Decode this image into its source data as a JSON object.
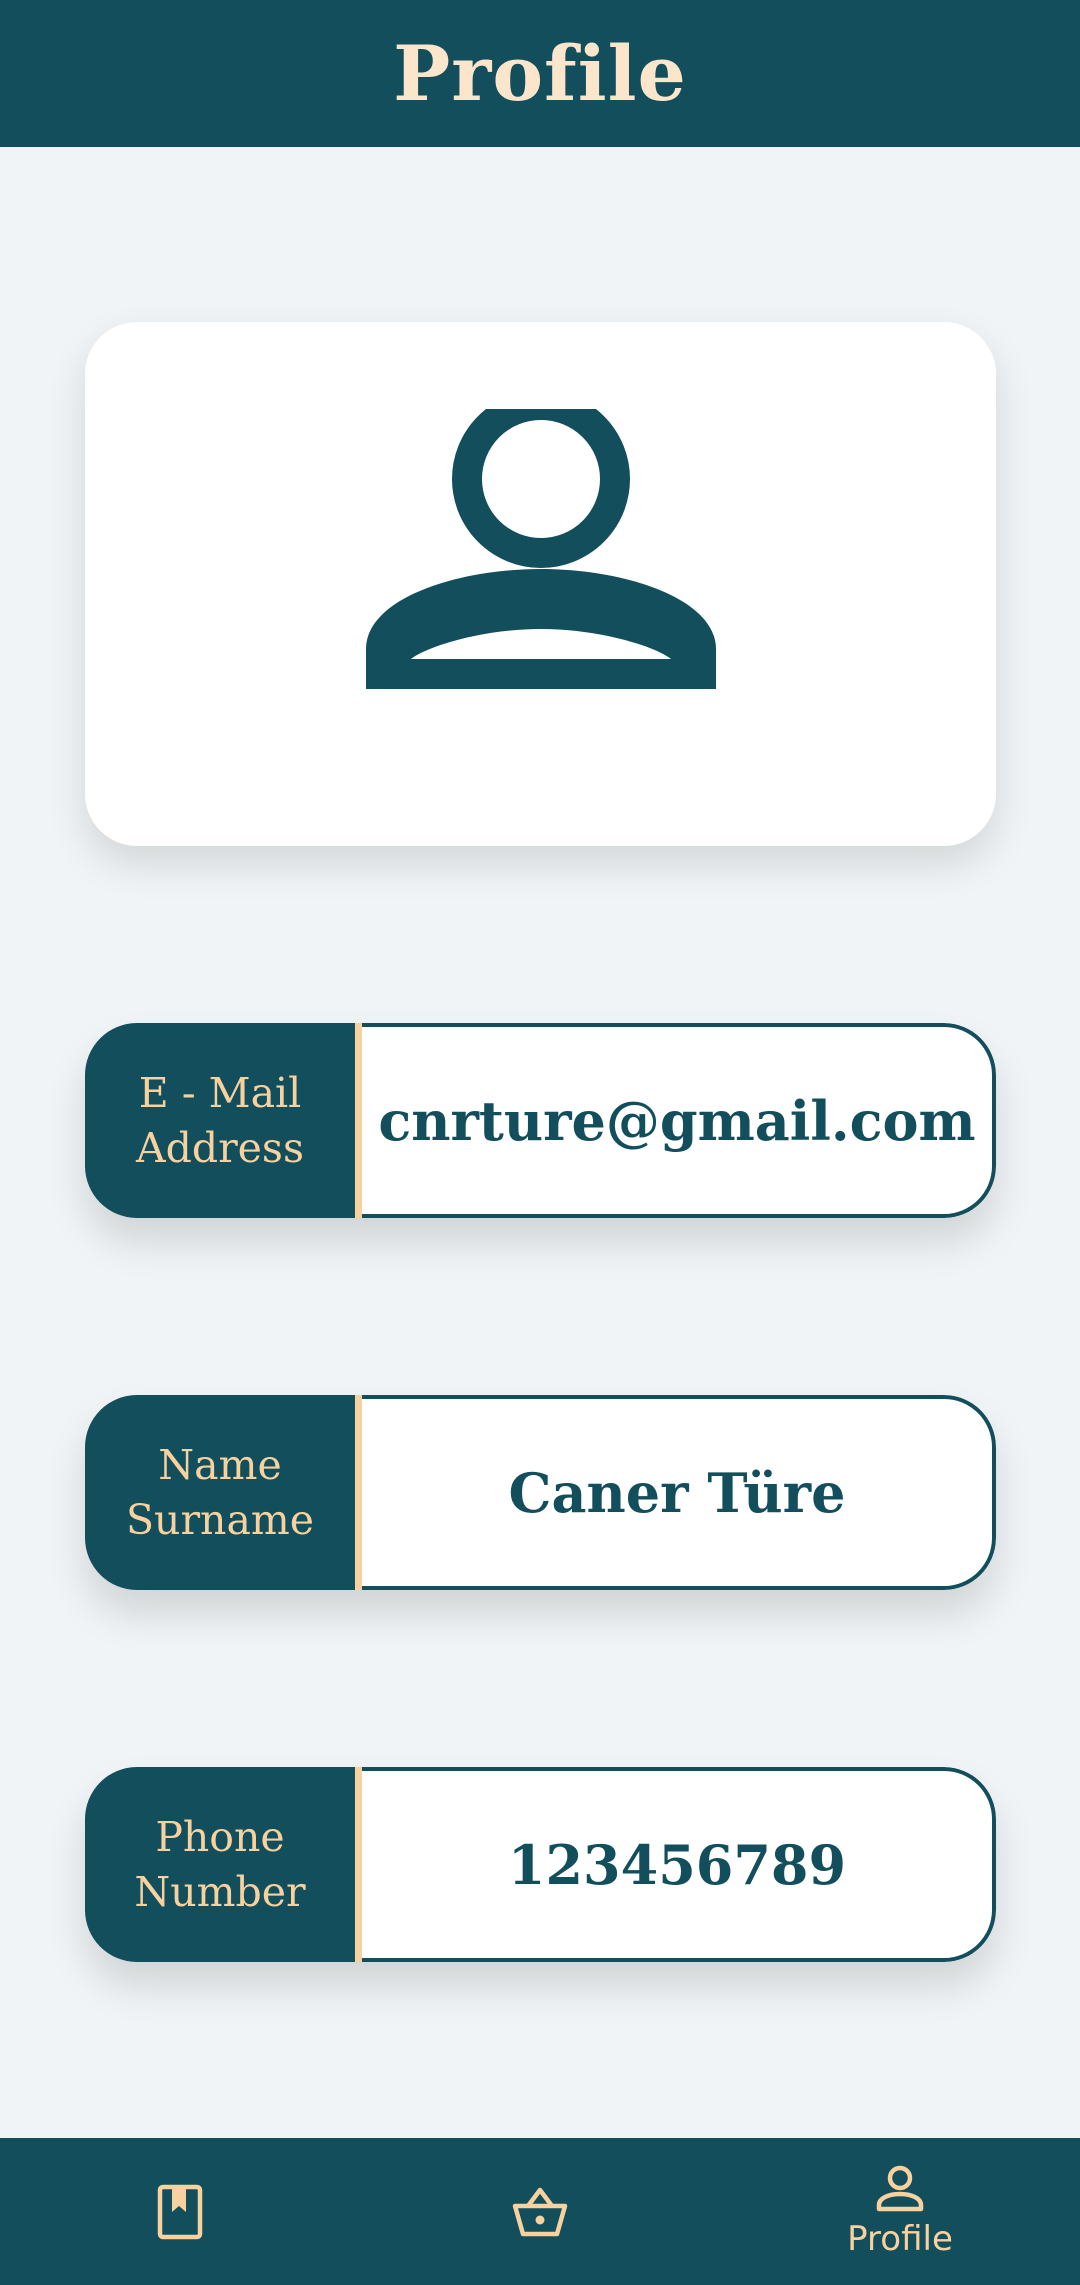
{
  "app_bar": {
    "title": "Profile"
  },
  "avatar": {
    "icon": "person-outline-icon"
  },
  "fields": [
    {
      "label": "E - Mail\nAddress",
      "value": "cnrture@gmail.com"
    },
    {
      "label": "Name\nSurname",
      "value": "Caner Türe"
    },
    {
      "label": "Phone\nNumber",
      "value": "123456789"
    }
  ],
  "bottom_nav": {
    "items": [
      {
        "icon": "bookmark-book-icon",
        "label": ""
      },
      {
        "icon": "basket-icon",
        "label": ""
      },
      {
        "icon": "person-icon",
        "label": "Profile",
        "selected": true
      }
    ]
  },
  "colors": {
    "primary": "#124E5C",
    "accent": "#F7D19E",
    "title": "#FBE6CB",
    "background": "#F0F4F6",
    "card": "#FFFFFF"
  }
}
